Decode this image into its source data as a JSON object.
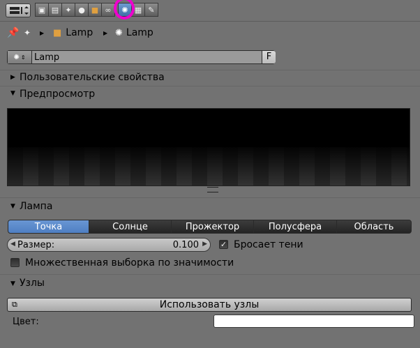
{
  "breadcrumb": {
    "items": [
      {
        "label": "Lamp",
        "icon": "object-cube-icon"
      },
      {
        "label": "Lamp",
        "icon": "lamp-icon"
      }
    ]
  },
  "datablock": {
    "name": "Lamp",
    "fake_user_label": "F"
  },
  "panels": {
    "custom_props_title": "Пользовательские свойства",
    "preview_title": "Предпросмотр",
    "lamp_title": "Лампа",
    "nodes_title": "Узлы"
  },
  "lamp": {
    "types": [
      {
        "label": "Точка",
        "selected": true
      },
      {
        "label": "Солнце",
        "selected": false
      },
      {
        "label": "Прожектор",
        "selected": false
      },
      {
        "label": "Полусфера",
        "selected": false
      },
      {
        "label": "Область",
        "selected": false
      }
    ],
    "size_label": "Размер:",
    "size_value": "0.100",
    "cast_shadows_label": "Бросает тени",
    "cast_shadows_checked": true,
    "multiple_importance_label": "Множественная выборка по значимости",
    "multiple_importance_checked": false
  },
  "nodes": {
    "use_nodes_label": "Использовать узлы",
    "color_label": "Цвет:",
    "color_value": "#ffffff"
  },
  "colors": {
    "accent": "#5a8ad0",
    "highlight_ring": "#ee00cc",
    "background": "#727272"
  }
}
